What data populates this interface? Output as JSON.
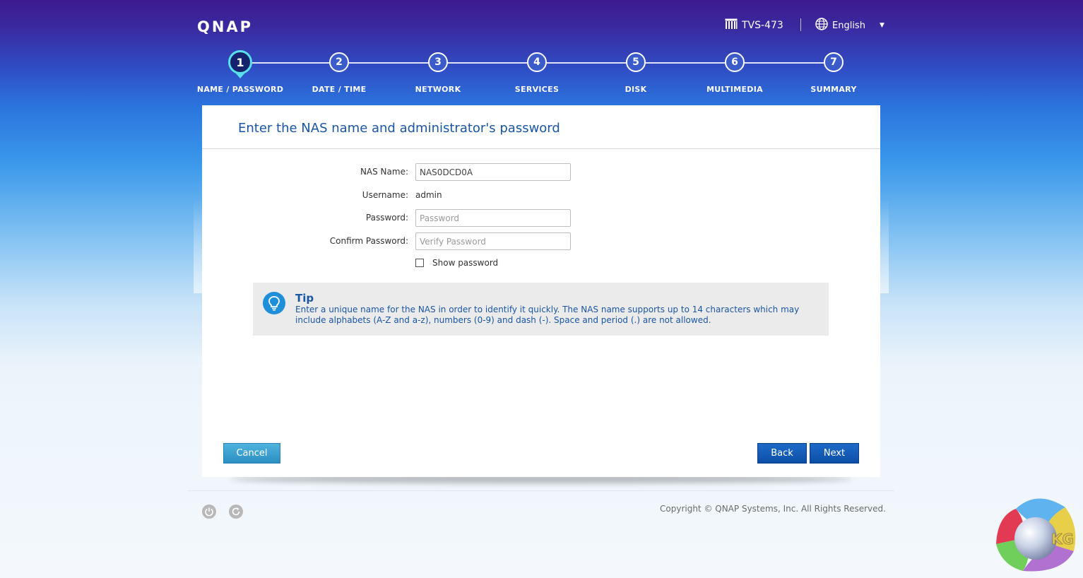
{
  "header": {
    "logo": "QNAP",
    "device_icon": "nas-device-icon",
    "device_name": "TVS-473",
    "language_icon": "globe-icon",
    "language": "English",
    "language_caret": "▼"
  },
  "wizard": {
    "active_step": 1,
    "steps": [
      {
        "number": "1",
        "label": "NAME / PASSWORD"
      },
      {
        "number": "2",
        "label": "DATE / TIME"
      },
      {
        "number": "3",
        "label": "NETWORK"
      },
      {
        "number": "4",
        "label": "SERVICES"
      },
      {
        "number": "5",
        "label": "DISK"
      },
      {
        "number": "6",
        "label": "MULTIMEDIA"
      },
      {
        "number": "7",
        "label": "SUMMARY"
      }
    ]
  },
  "panel": {
    "title": "Enter the NAS name and administrator's password",
    "form": {
      "nas_name_label": "NAS Name:",
      "nas_name_value": "NAS0DCD0A",
      "username_label": "Username:",
      "username_value": "admin",
      "password_label": "Password:",
      "password_placeholder": "Password",
      "confirm_label": "Confirm Password:",
      "confirm_placeholder": "Verify Password",
      "show_password_label": "Show password",
      "show_password_checked": false
    },
    "tip": {
      "icon": "lightbulb-icon",
      "title": "Tip",
      "text": "Enter a unique name for the NAS in order to identify it quickly. The NAS name supports up to 14 characters which may include alphabets (A-Z and a-z), numbers (0-9) and dash (-). Space and period (.) are not allowed."
    },
    "buttons": {
      "cancel": "Cancel",
      "back": "Back",
      "next": "Next"
    }
  },
  "footer": {
    "power_icon": "power-icon",
    "restart_icon": "restart-icon",
    "copyright": "Copyright © QNAP Systems, Inc. All Rights Reserved."
  },
  "watermark": {
    "text": "KG"
  },
  "colors": {
    "accent_blue": "#1a56a4",
    "button_blue": "#0d4ea7",
    "cancel_blue": "#2b8fc4",
    "active_step_ring": "#59e0ec"
  }
}
